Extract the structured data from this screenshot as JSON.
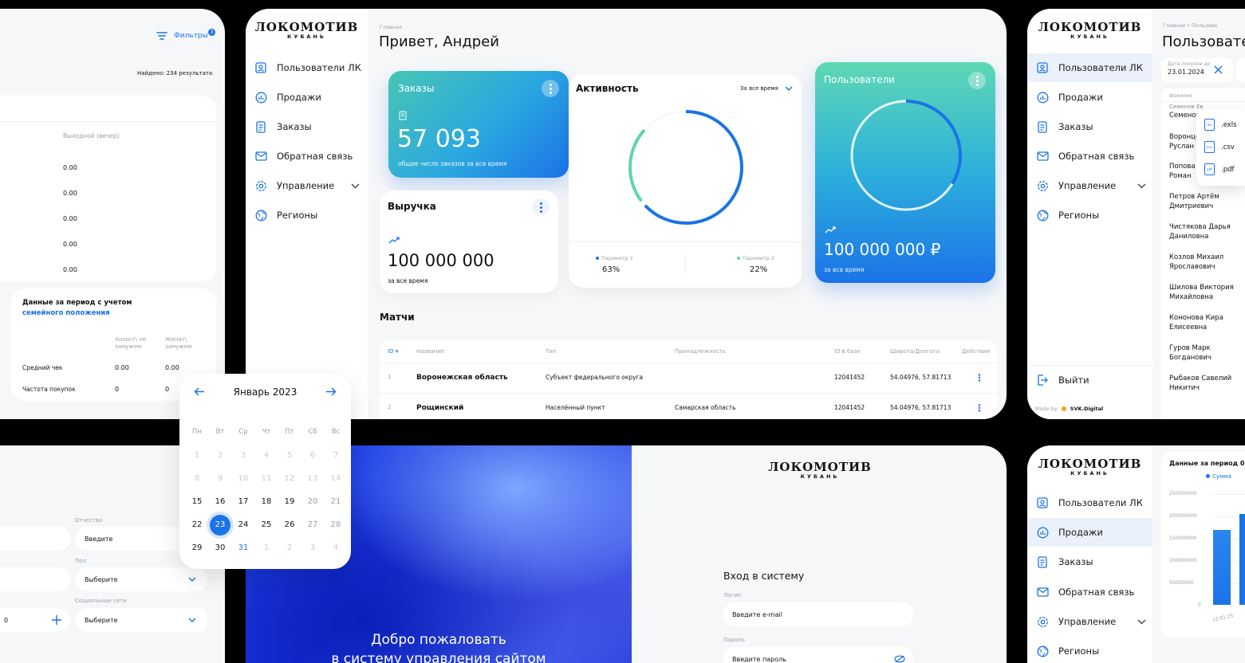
{
  "brand": {
    "name": "ЛОКОМОТИВ",
    "sub": "КУБАНЬ"
  },
  "nav": {
    "items": [
      "Пользователи ЛК",
      "Продажи",
      "Заказы",
      "Обратная связь",
      "Управление",
      "Регионы"
    ],
    "logout": "Выйти",
    "made_by_prefix": "Made by",
    "made_by": "SVK.Digital"
  },
  "tl": {
    "filters": "Фильтры",
    "filters_badge": "3",
    "found": "Найдено: 234 результата",
    "col_header": "Выходной (вечер)",
    "values": [
      "0.00",
      "0.00",
      "0.00",
      "0.00",
      "0.00"
    ],
    "period_title": "Данные за период с учетом",
    "period_link": "семейного положения",
    "col1": "Холост\\ не замужем",
    "col2": "Женат\\ замужем",
    "row1_label": "Средний чек",
    "row1_v1": "0.00",
    "row1_v2": "0.00",
    "row2_label": "Частота покупок",
    "row2_v1": "0",
    "row2_v2": "0"
  },
  "main": {
    "breadcrumb": "Главная",
    "greeting": "Привет, Андрей",
    "orders": {
      "title": "Заказы",
      "value": "57 093",
      "caption": "общее число заказов за все время"
    },
    "revenue": {
      "title": "Выручка",
      "value": "100 000 000",
      "caption": "за все время"
    },
    "activity": {
      "title": "Активность",
      "period": "За все время",
      "p1_label": "Параметр 1",
      "p1_value": "63%",
      "p2_label": "Параметр 2",
      "p2_value": "22%",
      "p1_fraction": 0.63,
      "p2_fraction": 0.22
    },
    "users": {
      "title": "Пользователи",
      "value": "100 000 000 ₽",
      "caption": "за все время",
      "ring_fraction": 0.75
    },
    "matches_title": "Матчи",
    "table": {
      "headers": [
        "ID",
        "Название",
        "Тип",
        "Принадлежность",
        "ID в базе",
        "Широта/Долгота",
        "Действия"
      ],
      "rows": [
        {
          "id": "1",
          "name": "Воронежская область",
          "type": "Субъект федерального округа",
          "owner": "",
          "db": "12041452",
          "coords": "54.04976, 57.81713"
        },
        {
          "id": "2",
          "name": "Рощинский",
          "type": "Населённый пункт",
          "owner": "Самарская область",
          "db": "12041452",
          "coords": "54.04976, 57.81713"
        }
      ]
    }
  },
  "tr": {
    "breadcrumb": "Главная • Пользова",
    "title": "Пользовате",
    "date_label": "Дата покупки до",
    "date_value": "23.01.2024",
    "list_label": "Фамилия",
    "names": [
      "Семенов",
      "Воронцов Руслан",
      "Попова Роман",
      "Петров Артём Дмитриевич",
      "Чистякова Дарья Даниловна",
      "Козлов Михаил Ярославович",
      "Шилова Виктория Михайловна",
      "Кононова Кира Елисеевна",
      "Гуров Марк Богданович",
      "Рыбаков Савелий Никитич"
    ],
    "exports": [
      ".exls",
      ".csv",
      ".pdf"
    ]
  },
  "calendar": {
    "month": "Январь 2023",
    "weekdays": [
      "Пн",
      "Вт",
      "Ср",
      "Чт",
      "Пт",
      "Сб",
      "Вс"
    ],
    "rows": [
      [
        "1",
        "2",
        "3",
        "4",
        "5",
        "6",
        "7"
      ],
      [
        "8",
        "9",
        "10",
        "11",
        "12",
        "13",
        "14"
      ],
      [
        "15",
        "16",
        "17",
        "18",
        "19",
        "20",
        "21"
      ],
      [
        "22",
        "23",
        "24",
        "25",
        "26",
        "27",
        "28"
      ],
      [
        "29",
        "30",
        "31",
        "1",
        "2",
        "3",
        "4"
      ]
    ],
    "selected": "23"
  },
  "bl": {
    "patronymic_label": "Отчество",
    "patronymic_placeholder": "Введите",
    "gender_label": "Пол",
    "gender_value": "Выберите",
    "social_label": "Социальные сети",
    "social_value": "Выберите",
    "left_value": "0"
  },
  "login": {
    "welcome1": "Добро пожаловать",
    "welcome2": "в систему управления сайтом",
    "title": "Вход в систему",
    "login_label": "Логин",
    "login_placeholder": "Введите e-mail",
    "password_label": "Пароль",
    "password_placeholder": "Введите пароль"
  },
  "br": {
    "period": "Данные за период 0",
    "legend": "Сумма",
    "yticks": [
      "250000000",
      "200000000",
      "150000000",
      "100000000",
      "50000000",
      "0"
    ],
    "xtick": "12.01.25"
  },
  "colors": {
    "accent": "#1b73e8",
    "teal": "#5fd4b0",
    "bg": "#f6f7f9"
  }
}
